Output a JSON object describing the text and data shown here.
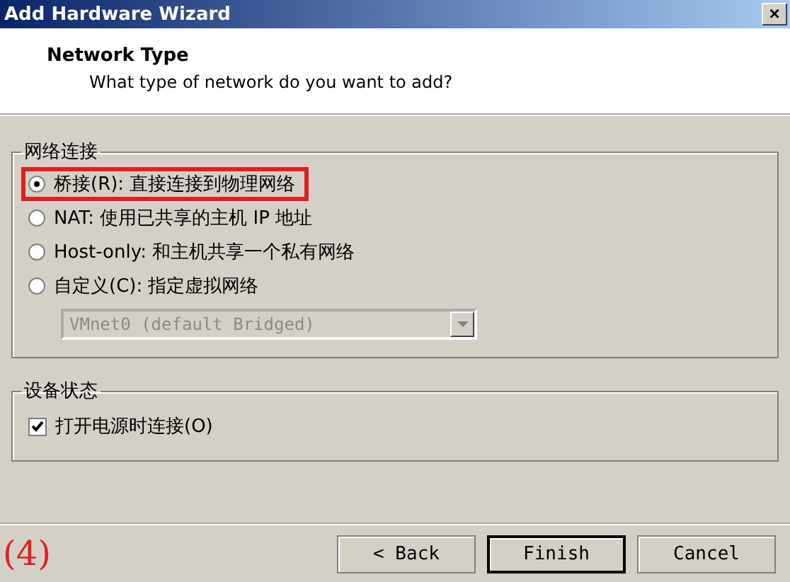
{
  "window": {
    "title": "Add Hardware Wizard",
    "close": "×"
  },
  "header": {
    "title": "Network Type",
    "subtitle": "What type of network do you want to add?"
  },
  "network_group": {
    "label": "网络连接",
    "options": [
      {
        "label": "桥接(R): 直接连接到物理网络",
        "selected": true,
        "highlighted": true
      },
      {
        "label": "NAT: 使用已共享的主机 IP 地址",
        "selected": false,
        "highlighted": false
      },
      {
        "label": "Host-only: 和主机共享一个私有网络",
        "selected": false,
        "highlighted": false
      },
      {
        "label": "自定义(C): 指定虚拟网络",
        "selected": false,
        "highlighted": false
      }
    ],
    "dropdown": {
      "value": "VMnet0 (default Bridged)",
      "disabled": true
    }
  },
  "device_group": {
    "label": "设备状态",
    "checkbox": {
      "label": "打开电源时连接(O)",
      "checked": true
    }
  },
  "annotation": "(4)",
  "buttons": [
    {
      "label": "< Back",
      "focused": false
    },
    {
      "label": "Finish",
      "focused": true
    },
    {
      "label": "Cancel",
      "focused": false
    }
  ]
}
